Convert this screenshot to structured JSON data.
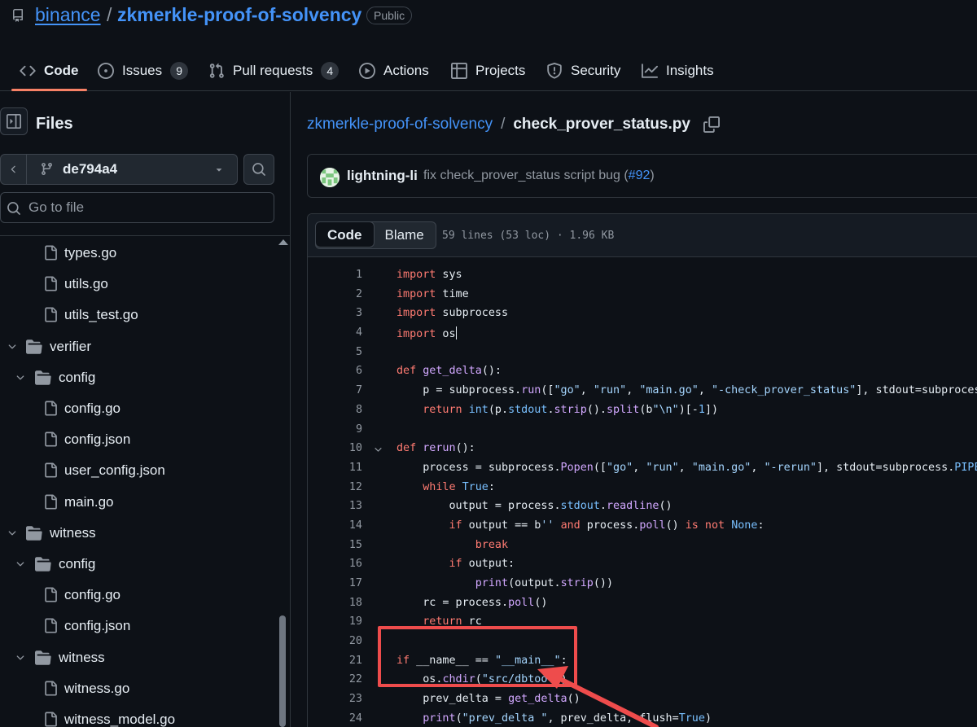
{
  "repo": {
    "owner": "binance",
    "separator": "/",
    "name": "zkmerkle-proof-of-solvency",
    "visibility": "Public"
  },
  "nav": {
    "tabs": [
      {
        "label": "Code",
        "icon": "code-icon",
        "active": true
      },
      {
        "label": "Issues",
        "icon": "issue-opened-icon",
        "count": "9"
      },
      {
        "label": "Pull requests",
        "icon": "git-pull-request-icon",
        "count": "4"
      },
      {
        "label": "Actions",
        "icon": "play-icon"
      },
      {
        "label": "Projects",
        "icon": "table-icon"
      },
      {
        "label": "Security",
        "icon": "shield-icon"
      },
      {
        "label": "Insights",
        "icon": "graph-icon"
      }
    ]
  },
  "sidebar": {
    "title": "Files",
    "branch": "de794a4",
    "goto_placeholder": "Go to file",
    "tree": [
      {
        "label": "types.go",
        "type": "file",
        "depth": 1
      },
      {
        "label": "utils.go",
        "type": "file",
        "depth": 1
      },
      {
        "label": "utils_test.go",
        "type": "file",
        "depth": 1
      },
      {
        "label": "verifier",
        "type": "dir",
        "depth": 0
      },
      {
        "label": "config",
        "type": "dir",
        "depth": 1
      },
      {
        "label": "config.go",
        "type": "file",
        "depth": 2
      },
      {
        "label": "config.json",
        "type": "file",
        "depth": 2
      },
      {
        "label": "user_config.json",
        "type": "file",
        "depth": 2
      },
      {
        "label": "main.go",
        "type": "file",
        "depth": 1
      },
      {
        "label": "witness",
        "type": "dir",
        "depth": 0
      },
      {
        "label": "config",
        "type": "dir",
        "depth": 1
      },
      {
        "label": "config.go",
        "type": "file",
        "depth": 2
      },
      {
        "label": "config.json",
        "type": "file",
        "depth": 2
      },
      {
        "label": "witness",
        "type": "dir",
        "depth": 1
      },
      {
        "label": "witness.go",
        "type": "file",
        "depth": 2
      },
      {
        "label": "witness_model.go",
        "type": "file",
        "depth": 2
      }
    ]
  },
  "breadcrumb": {
    "repo_link": "zkmerkle-proof-of-solvency",
    "separator": "/",
    "file": "check_prover_status.py"
  },
  "commit": {
    "author": "lightning-li",
    "message": "fix check_prover_status script bug (",
    "pr_link": "#92",
    "message_end": ")"
  },
  "file_view": {
    "tab_code": "Code",
    "tab_blame": "Blame",
    "info": "59 lines (53 loc) · 1.96 KB"
  },
  "code_lines": [
    {
      "n": "1",
      "html": "<span class=\"kw\">import</span> sys"
    },
    {
      "n": "2",
      "html": "<span class=\"kw\">import</span> time"
    },
    {
      "n": "3",
      "html": "<span class=\"kw\">import</span> subprocess"
    },
    {
      "n": "4",
      "html": "<span class=\"kw\">import</span> os<span class=\"caret\"></span>"
    },
    {
      "n": "5",
      "html": ""
    },
    {
      "n": "6",
      "html": "<span class=\"kw\">def</span> <span class=\"fn\">get_delta</span>():"
    },
    {
      "n": "7",
      "html": "    p = subprocess.<span class=\"fn\">run</span>([<span class=\"st\">\"go\"</span>, <span class=\"st\">\"run\"</span>, <span class=\"st\">\"main.go\"</span>, <span class=\"st\">\"-check_prover_status\"</span>], stdout=subprocess.<span class=\"cn\">PIPE</span>)"
    },
    {
      "n": "8",
      "html": "    <span class=\"kw\">return</span> <span class=\"cn\">int</span>(p.<span class=\"cn\">stdout</span>.<span class=\"fn\">strip</span>().<span class=\"fn\">split</span>(b<span class=\"st\">\"\\n\"</span>)[-<span class=\"cn\">1</span>])"
    },
    {
      "n": "9",
      "html": ""
    },
    {
      "n": "10",
      "html": "<span class=\"kw\">def</span> <span class=\"fn\">rerun</span>():",
      "fold": true
    },
    {
      "n": "11",
      "html": "    process = subprocess.<span class=\"fn\">Popen</span>([<span class=\"st\">\"go\"</span>, <span class=\"st\">\"run\"</span>, <span class=\"st\">\"main.go\"</span>, <span class=\"st\">\"-rerun\"</span>], stdout=subprocess.<span class=\"cn\">PIPE</span>)"
    },
    {
      "n": "12",
      "html": "    <span class=\"kw\">while</span> <span class=\"cn\">True</span>:"
    },
    {
      "n": "13",
      "html": "        output = process.<span class=\"cn\">stdout</span>.<span class=\"fn\">readline</span>()"
    },
    {
      "n": "14",
      "html": "        <span class=\"kw\">if</span> output == b<span class=\"st\">''</span> <span class=\"kw\">and</span> process.<span class=\"fn\">poll</span>() <span class=\"kw\">is not</span> <span class=\"cn\">None</span>:"
    },
    {
      "n": "15",
      "html": "            <span class=\"kw\">break</span>"
    },
    {
      "n": "16",
      "html": "        <span class=\"kw\">if</span> output:"
    },
    {
      "n": "17",
      "html": "            <span class=\"fn\">print</span>(output.<span class=\"fn\">strip</span>())"
    },
    {
      "n": "18",
      "html": "    rc = process.<span class=\"fn\">poll</span>()"
    },
    {
      "n": "19",
      "html": "    <span class=\"kw\">return</span> rc"
    },
    {
      "n": "20",
      "html": ""
    },
    {
      "n": "21",
      "html": "<span class=\"kw\">if</span> __name__ == <span class=\"st\">\"__main__\"</span>:"
    },
    {
      "n": "22",
      "html": "    os.<span class=\"fn\">chdir</span>(<span class=\"st\">\"src/dbtool\"</span>)"
    },
    {
      "n": "23",
      "html": "    prev_delta = <span class=\"fn\">get_delta</span>()"
    },
    {
      "n": "24",
      "html": "    <span class=\"fn\">print</span>(<span class=\"st\">\"prev_delta \"</span>, prev_delta, flush=<span class=\"cn\">True</span>)"
    }
  ],
  "colors": {
    "accent_link": "#4493f8",
    "active_tab_underline": "#f78166",
    "annotation": "#ee4c4c"
  }
}
